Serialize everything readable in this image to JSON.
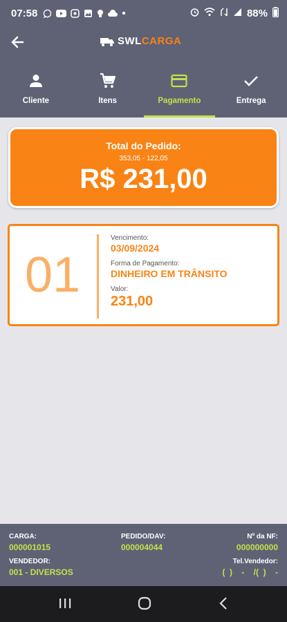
{
  "status_bar": {
    "time": "07:58",
    "battery": "88%"
  },
  "app": {
    "logo_swl": "SWL",
    "logo_carga": "CARGA"
  },
  "tabs": [
    {
      "label": "Cliente",
      "icon": "person-icon"
    },
    {
      "label": "Itens",
      "icon": "cart-icon"
    },
    {
      "label": "Pagamento",
      "icon": "credit-card-icon",
      "active": true
    },
    {
      "label": "Entrega",
      "icon": "check-icon"
    }
  ],
  "total": {
    "title": "Total do Pedido:",
    "calc": "353,05 - 122,05",
    "value": "R$ 231,00"
  },
  "installment": {
    "number": "01",
    "due_label": "Vencimento:",
    "due_value": "03/09/2024",
    "method_label": "Forma de Pagamento:",
    "method_value": "DINHEIRO EM TRÂNSITO",
    "amount_label": "Valor:",
    "amount_value": "231,00"
  },
  "footer": {
    "carga_label": "CARGA:",
    "carga_value": "000001015",
    "pedido_label": "PEDIDO/DAV:",
    "pedido_value": "000004044",
    "nf_label": "Nº da NF:",
    "nf_value": "000000000",
    "vendedor_label": "VENDEDOR:",
    "vendedor_value": "001 - DIVERSOS",
    "tel_label": "Tel.Vendedor:",
    "tel_value": "(  )    -    /(  )    -"
  },
  "colors": {
    "header": "#5f6275",
    "accent_orange": "#f98315",
    "accent_green": "#c5e04a",
    "background": "#e6e6ea"
  }
}
